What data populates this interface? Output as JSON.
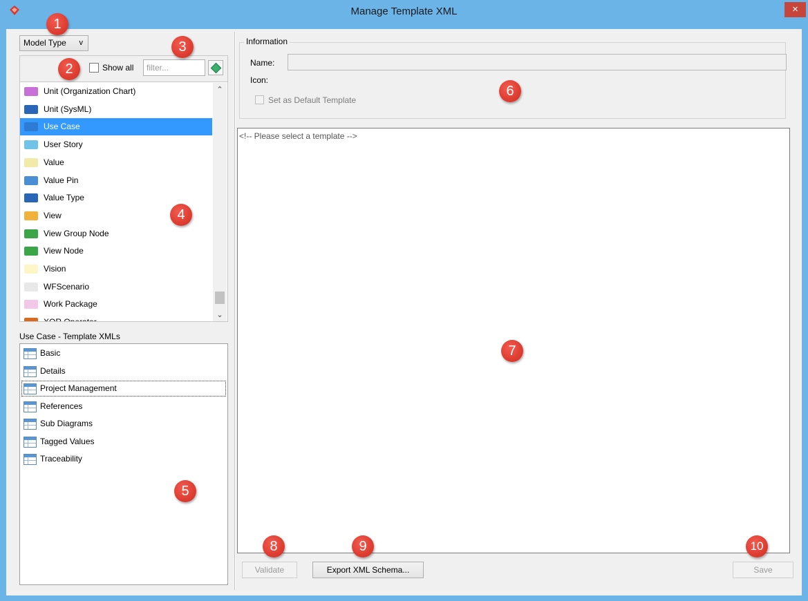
{
  "window": {
    "title": "Manage Template XML",
    "close_glyph": "×",
    "app_icon": "app-logo-icon"
  },
  "left": {
    "model_type": {
      "label": "Model Type",
      "chevron": "v"
    },
    "show_all_label": "Show all",
    "filter": {
      "placeholder": "filter...",
      "value": ""
    },
    "items": [
      {
        "label": "Unit (Organization Chart)",
        "icon": "unit-org-icon",
        "color": "#c86fd8"
      },
      {
        "label": "Unit (SysML)",
        "icon": "unit-sysml-icon",
        "color": "#2a66b8"
      },
      {
        "label": "Use Case",
        "icon": "use-case-icon",
        "color": "#2e7bd6",
        "selected": true
      },
      {
        "label": "User Story",
        "icon": "user-story-icon",
        "color": "#6fc3e8"
      },
      {
        "label": "Value",
        "icon": "value-icon",
        "color": "#f3eaa8"
      },
      {
        "label": "Value Pin",
        "icon": "value-pin-icon",
        "color": "#4a8ed6"
      },
      {
        "label": "Value Type",
        "icon": "value-type-icon",
        "color": "#2a66b8"
      },
      {
        "label": "View",
        "icon": "view-icon",
        "color": "#f0b23a"
      },
      {
        "label": "View Group Node",
        "icon": "view-group-node-icon",
        "color": "#3aa648"
      },
      {
        "label": "View Node",
        "icon": "view-node-icon",
        "color": "#3aa648"
      },
      {
        "label": "Vision",
        "icon": "vision-icon",
        "color": "#fff6c8"
      },
      {
        "label": "WFScenario",
        "icon": "wfscenario-icon",
        "color": "#e8e8e8"
      },
      {
        "label": "Work Package",
        "icon": "work-package-icon",
        "color": "#f2c7e8"
      },
      {
        "label": "XOR Operator",
        "icon": "xor-operator-icon",
        "color": "#d96a1e"
      }
    ],
    "templates_label": "Use Case - Template XMLs",
    "templates": [
      {
        "label": "Basic"
      },
      {
        "label": "Details"
      },
      {
        "label": "Project Management",
        "focused": true
      },
      {
        "label": "References"
      },
      {
        "label": "Sub Diagrams"
      },
      {
        "label": "Tagged Values"
      },
      {
        "label": "Traceability"
      }
    ]
  },
  "info": {
    "group_label": "Information",
    "name_label": "Name:",
    "name_value": "",
    "icon_label": "Icon:",
    "default_label": "Set as Default Template"
  },
  "editor": {
    "text": "<!-- Please select a template -->"
  },
  "buttons": {
    "validate": "Validate",
    "export": "Export XML Schema...",
    "save": "Save"
  },
  "callouts": [
    "1",
    "2",
    "3",
    "4",
    "5",
    "6",
    "7",
    "8",
    "9",
    "10"
  ]
}
